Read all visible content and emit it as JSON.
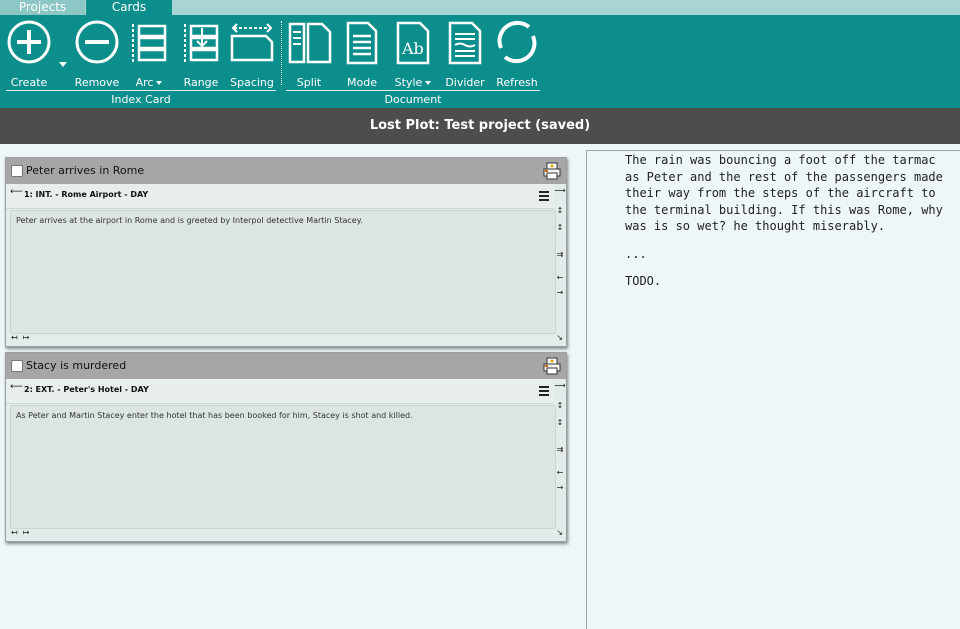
{
  "tabs": [
    {
      "label": "Projects"
    },
    {
      "label": "Cards"
    }
  ],
  "ribbon": {
    "buttons": [
      {
        "label": "Create",
        "icon": "plus-circle-icon"
      },
      {
        "label": "Remove",
        "icon": "minus-circle-icon"
      },
      {
        "label": "Arc",
        "icon": "arc-icon"
      },
      {
        "label": "Range",
        "icon": "range-icon"
      },
      {
        "label": "Spacing",
        "icon": "spacing-icon"
      },
      {
        "label": "Split",
        "icon": "split-icon"
      },
      {
        "label": "Mode",
        "icon": "document-icon"
      },
      {
        "label": "Style",
        "icon": "style-icon"
      },
      {
        "label": "Divider",
        "icon": "divider-icon"
      },
      {
        "label": "Refresh",
        "icon": "refresh-icon"
      }
    ],
    "groups": [
      {
        "label": "Index Card"
      },
      {
        "label": "Document"
      }
    ]
  },
  "title": "Lost Plot: Test project (saved)",
  "cards": [
    {
      "title": "Peter arrives in Rome",
      "scene": "1: INT. - Rome Airport - DAY",
      "body": "Peter arrives at the airport in Rome and is greeted by Interpol detective Martin Stacey."
    },
    {
      "title": "Stacy is murdered",
      "scene": "2: EXT. - Peter's Hotel - DAY",
      "body": "As Peter and Martin Stacey enter the hotel that has been booked for him, Stacey is shot and killed."
    }
  ],
  "document": {
    "paragraphs": [
      "The rain was bouncing a foot off the tarmac as Peter and the rest of the passengers made their way from the steps of the aircraft to the terminal building. If this was Rome, why was is so wet? he thought miserably.",
      "...",
      "TODO."
    ]
  },
  "colors": {
    "ribbon": "#0c8f8c",
    "tabbar": "#a9d4d4",
    "titlebar": "#4d4d4d",
    "card_header": "#a6a6a6"
  }
}
